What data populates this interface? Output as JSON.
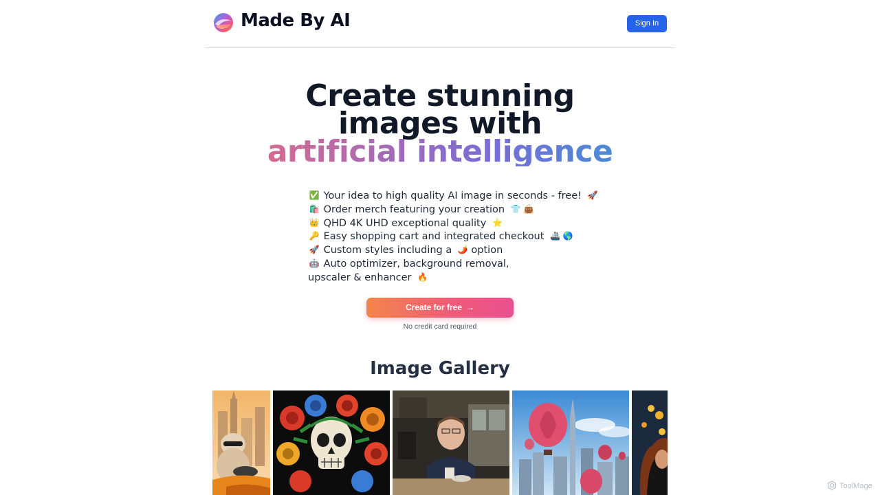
{
  "header": {
    "brand": "Made By AI",
    "logo_icon": "swirl-logo-icon",
    "signin_label": "Sign In",
    "signin_color": "#2563eb"
  },
  "hero": {
    "line1": "Create stunning",
    "line2": "images with",
    "line3": "artificial intelligence"
  },
  "features": [
    {
      "emoji": "✅",
      "text": "Your idea to high quality AI image in seconds - free!",
      "emoji_after": "🚀"
    },
    {
      "emoji": "🛍️",
      "text": "Order merch featuring your creation",
      "emoji_after": "👕 👜"
    },
    {
      "emoji": "👑",
      "text": "QHD 4K UHD exceptional quality",
      "emoji_after": "⭐"
    },
    {
      "emoji": "🔑",
      "text": "Easy shopping cart and integrated checkout",
      "emoji_after": "🚢 🌎"
    },
    {
      "emoji": "🚀",
      "text": "Custom styles including a",
      "emoji_after": "🌶️",
      "text_after": "option"
    },
    {
      "emoji": "🤖",
      "text": "Auto optimizer, background removal, upscaler & enhancer",
      "emoji_after": "🔥"
    }
  ],
  "cta": {
    "label": "Create for free",
    "arrow_icon": "arrow-right-icon",
    "note": "No credit card required"
  },
  "gallery": {
    "title": "Image Gallery",
    "images": [
      {
        "name": "gallery-image-cat-driving-city"
      },
      {
        "name": "gallery-image-skull-roses"
      },
      {
        "name": "gallery-image-man-cafe"
      },
      {
        "name": "gallery-image-balloons-city"
      },
      {
        "name": "gallery-image-woman-lights"
      }
    ]
  },
  "watermark": "ToolMage"
}
